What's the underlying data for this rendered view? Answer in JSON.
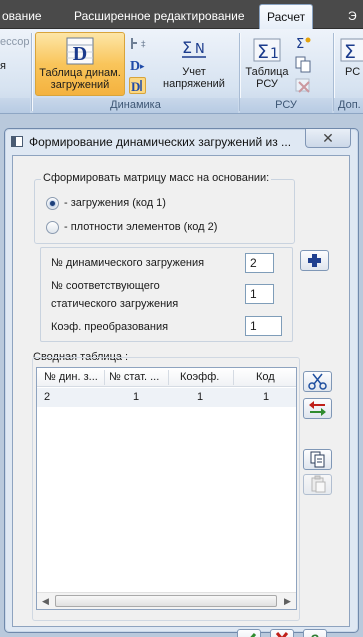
{
  "ribbon": {
    "tabs": [
      {
        "label": "ование"
      },
      {
        "label": "Расширенное редактирование"
      },
      {
        "label": "Расчет"
      },
      {
        "label": "Э"
      }
    ],
    "left_button": {
      "top_label": "ессор",
      "bottom_label": "я"
    },
    "dynamics": {
      "group_label": "Динамика",
      "table_button": "Таблица динам.\nзагружений",
      "stress_button": "Учет\nнапряжений"
    },
    "rsu": {
      "group_label": "РСУ",
      "table_button": "Таблица\nРСУ"
    },
    "extra": {
      "group_label": "Доп.",
      "button": "РС"
    }
  },
  "dialog": {
    "title": "Формирование динамических загружений из ...",
    "close_glyph": "✕",
    "mass_group": {
      "label": "Сформировать матрицу масс на основании:",
      "options": [
        {
          "label": "- загружения (код 1)",
          "checked": true
        },
        {
          "label": "- плотности элементов (код 2)",
          "checked": false
        }
      ]
    },
    "fields": {
      "dyn_load_label": "№  динамического загружения",
      "dyn_load_value": "2",
      "static_load_label_1": "№ соответствующего",
      "static_load_label_2": "статического загружения",
      "static_load_value": "1",
      "coef_label": "Коэф. преобразования",
      "coef_value": "1"
    },
    "summary": {
      "label": "Сводная таблица :",
      "columns": [
        "№ дин. з...",
        "№ стат. ...",
        "Коэфф.",
        "Код"
      ],
      "rows": [
        [
          "2",
          "1",
          "1",
          "1"
        ]
      ]
    },
    "buttons": {
      "ok_glyph": "✔",
      "cancel_glyph": "✖",
      "help_glyph": "?"
    },
    "colors": {
      "ok_green": "#2e8b2e",
      "cancel_red": "#c0201a",
      "help_green": "#2e7d32",
      "add_blue": "#1f3f8f"
    }
  }
}
